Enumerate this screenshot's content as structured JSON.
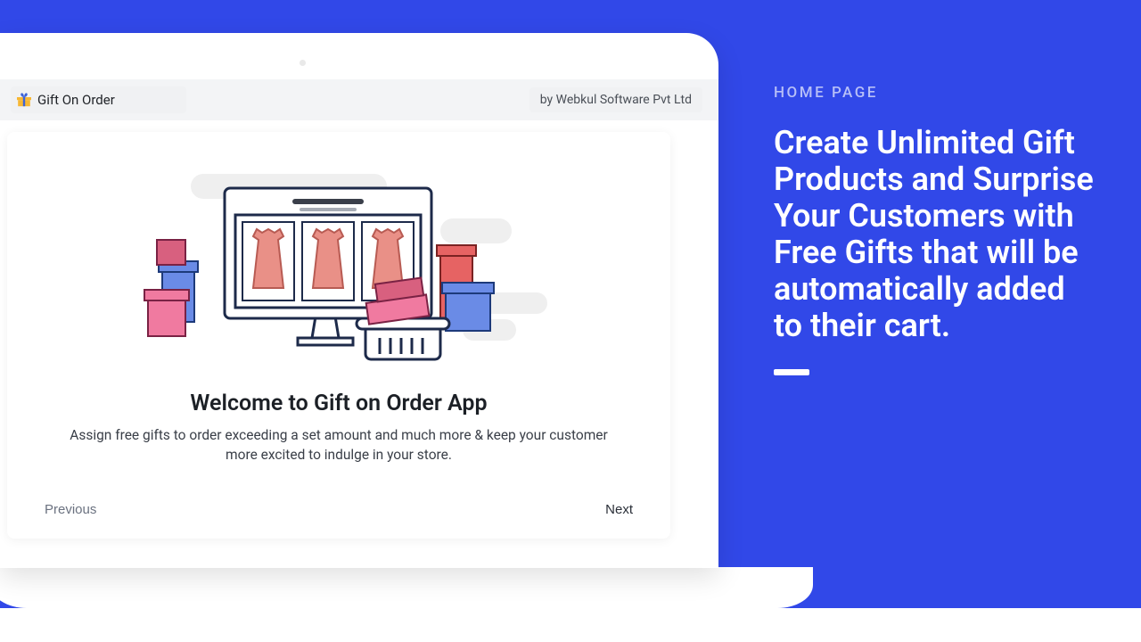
{
  "header": {
    "app_title": "Gift On Order",
    "by_line": "by Webkul Software Pvt Ltd"
  },
  "card": {
    "heading": "Welcome to Gift on Order App",
    "subtext": "Assign free gifts to order exceeding a set amount and much more & keep your customer more excited to indulge in your store.",
    "prev_label": "Previous",
    "next_label": "Next"
  },
  "sidebar": {
    "kicker": "HOME PAGE",
    "headline": "Create Unlimited Gift Products and Surprise Your Customers with Free Gifts that will be automatically added to their cart."
  }
}
